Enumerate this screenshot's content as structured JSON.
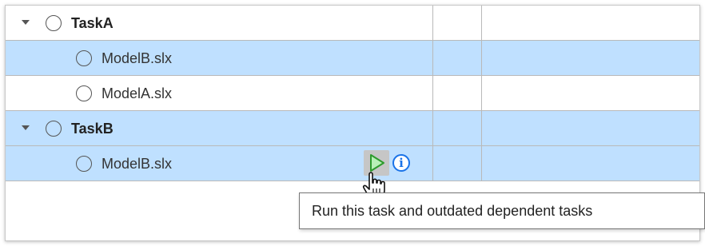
{
  "tree": {
    "rows": [
      {
        "label": "TaskA",
        "kind": "task",
        "expanded": true,
        "selected": false
      },
      {
        "label": "ModelB.slx",
        "kind": "model",
        "selected": true
      },
      {
        "label": "ModelA.slx",
        "kind": "model",
        "selected": false
      },
      {
        "label": "TaskB",
        "kind": "task",
        "expanded": true,
        "selected": true
      },
      {
        "label": "ModelB.slx",
        "kind": "model",
        "selected": true,
        "hovered": true
      }
    ]
  },
  "actions": {
    "run_icon": "play-icon",
    "info_icon": "info-icon",
    "info_glyph": "i"
  },
  "tooltip": {
    "text": "Run this task and outdated dependent tasks"
  },
  "colors": {
    "selected_row": "#bfe0ff",
    "grid_line": "#b9b9b9",
    "run_icon_fill": "#b8f0b8",
    "run_icon_stroke": "#2e9b2e",
    "info_accent": "#1a73e8"
  }
}
